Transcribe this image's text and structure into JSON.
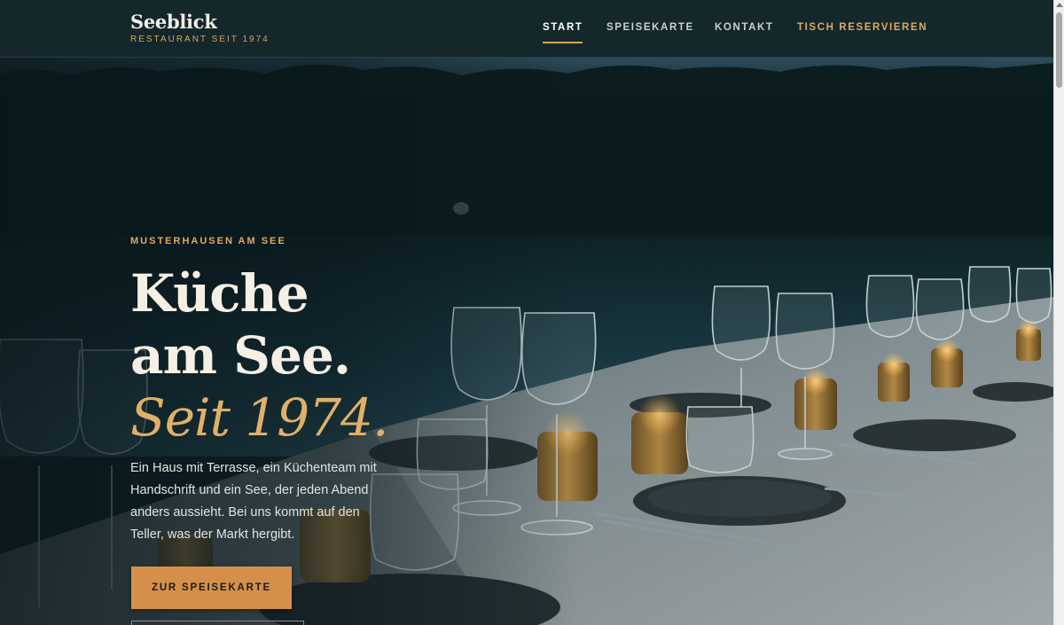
{
  "brand": {
    "name": "Seeblick",
    "tagline": "RESTAURANT SEIT 1974"
  },
  "nav": {
    "items": [
      {
        "label": "START",
        "active": true
      },
      {
        "label": "SPEISEKARTE",
        "active": false
      },
      {
        "label": "KONTAKT",
        "active": false
      },
      {
        "label": "TISCH RESERVIEREN",
        "active": false
      }
    ]
  },
  "hero": {
    "eyebrow": "MUSTERHAUSEN AM SEE",
    "headline": {
      "line1": "Küche",
      "line2": "am See.",
      "accent": "Seit 1974."
    },
    "lead": "Ein Haus mit Terrasse, ein Küchenteam mit Handschrift und ein See, der jeden Abend anders aussieht. Bei uns kommt auf den Teller, was der Markt hergibt.",
    "cta_label": "ZUR SPEISEKARTE"
  },
  "colors": {
    "header_bg": "#14272b",
    "accent_gold": "#e0a95c",
    "cta_bg": "#d4904b",
    "headline": "#f5efe4"
  }
}
